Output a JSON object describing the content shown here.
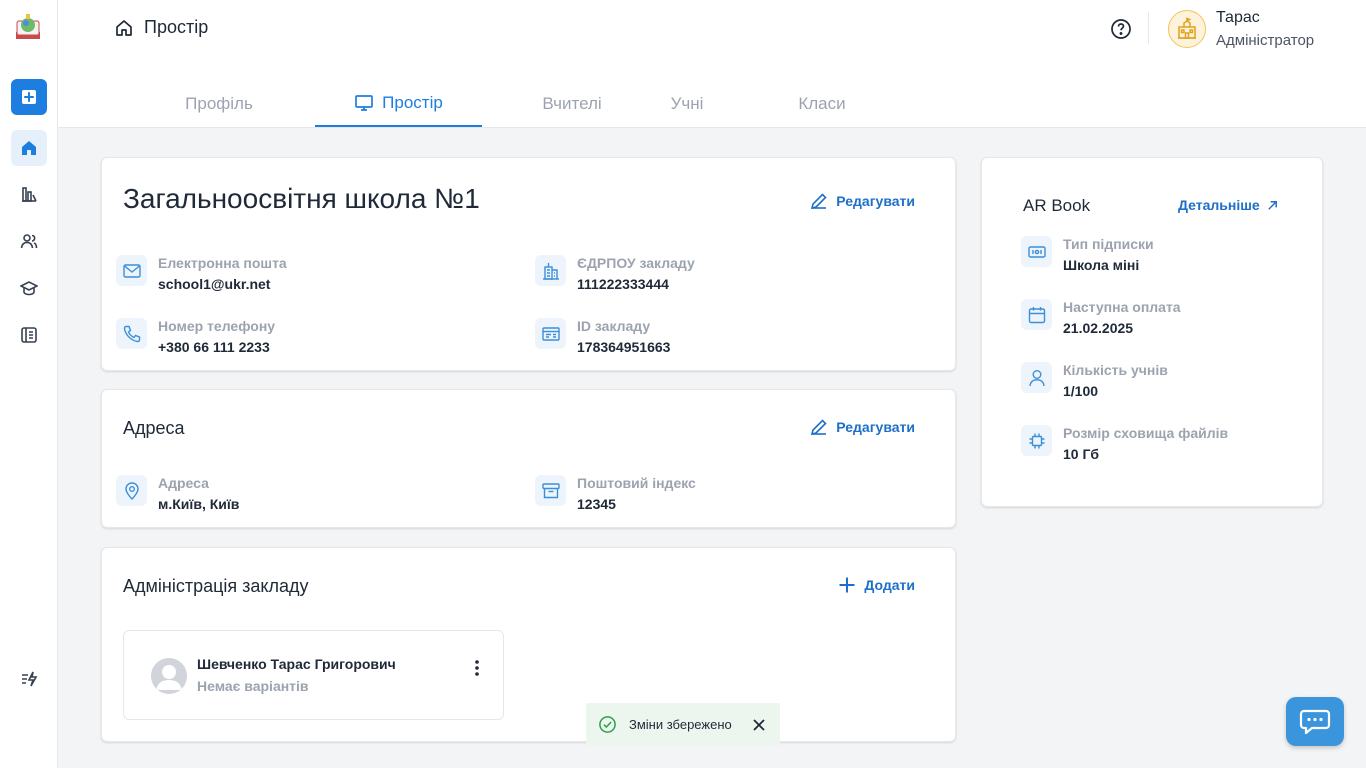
{
  "header": {
    "breadcrumb": "Простір",
    "user": {
      "name": "Тарас",
      "role": "Адміністратор"
    }
  },
  "tabs": [
    {
      "label": "Профіль"
    },
    {
      "label": "Простір"
    },
    {
      "label": "Вчителі"
    },
    {
      "label": "Учні"
    },
    {
      "label": "Класи"
    }
  ],
  "school_card": {
    "title": "Загальноосвітня школа №1",
    "edit_label": "Редагувати",
    "fields": [
      {
        "label": "Електронна пошта",
        "value": "school1@ukr.net"
      },
      {
        "label": "ЄДРПОУ закладу",
        "value": "111222333444"
      },
      {
        "label": "Номер телефону",
        "value": "+380 66 111 2233"
      },
      {
        "label": "ID закладу",
        "value": "178364951663"
      }
    ]
  },
  "address_card": {
    "title": "Адреса",
    "edit_label": "Редагувати",
    "fields": [
      {
        "label": "Адреса",
        "value": "м.Київ, Київ"
      },
      {
        "label": "Поштовий індекс",
        "value": "12345"
      }
    ]
  },
  "admin_card": {
    "title": "Адміністрація закладу",
    "add_label": "Додати",
    "items": [
      {
        "name": "Шевченко Тарас Григорович",
        "subtitle": "Немає варіантів"
      }
    ]
  },
  "subscription_card": {
    "title": "AR Book",
    "link_label": "Детальніше",
    "fields": [
      {
        "label": "Тип підписки",
        "value": "Школа міні"
      },
      {
        "label": "Наступна оплата",
        "value": "21.02.2025"
      },
      {
        "label": "Кількість учнів",
        "value": "1/100"
      },
      {
        "label": "Розмір сховища файлів",
        "value": "10 Гб"
      }
    ]
  },
  "toast": {
    "message": "Зміни збережено"
  },
  "colors": {
    "accent": "#1d7ee0",
    "link": "#1d6fc9",
    "success": "#2e9e4f",
    "chat": "#3b95dc"
  }
}
